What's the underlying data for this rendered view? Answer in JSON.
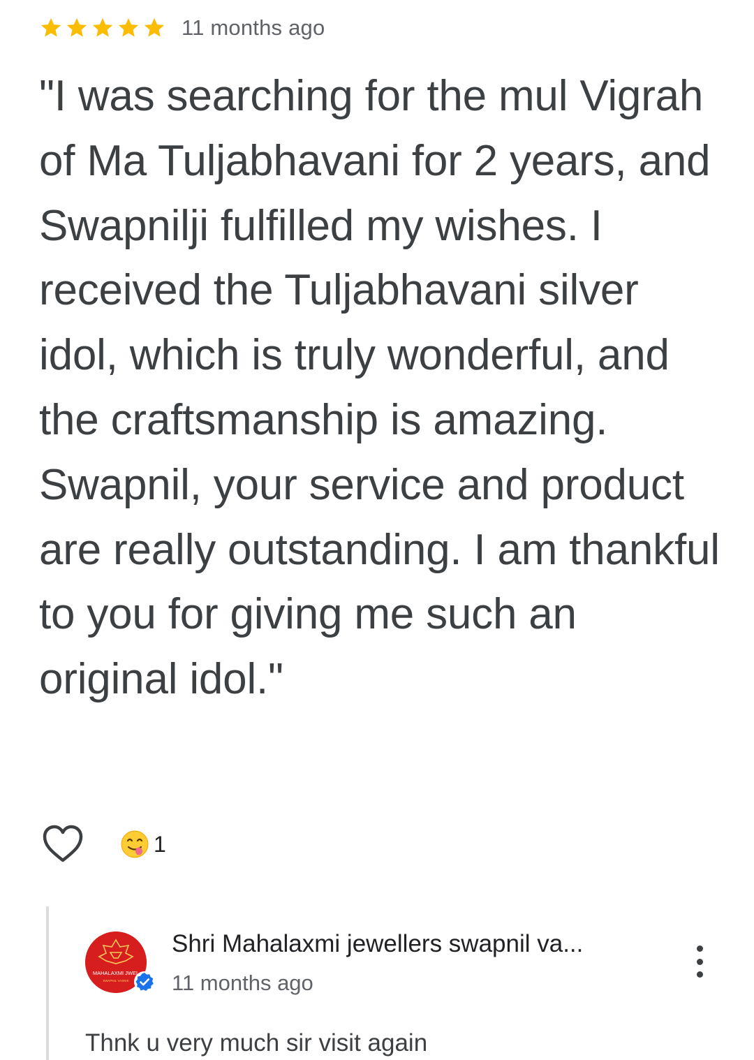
{
  "review": {
    "rating": 5,
    "max_rating": 5,
    "time": "11 months ago",
    "text": "\"I was searching for the mul Vigrah of Ma Tuljabhavani for 2 years, and Swapnilji fulfilled my wishes. I received the Tuljabhavani silver idol, which is truly wonderful, and the craftsmanship is amazing. Swapnil, your service and product are really outstanding. I am thankful to you for giving me such an original idol.\""
  },
  "reactions": {
    "like_icon": "heart-outline-icon",
    "emoji_icon": "savoring-food-emoji-icon",
    "emoji_count": "1"
  },
  "owner_reply": {
    "name": "Shri Mahalaxmi jewellers swapnil va...",
    "time": "11 months ago",
    "text": "Thnk u very much sir visit again",
    "avatar_label": "MAHALAXMI JWEL",
    "avatar_sublabel": "SWAPNIL VASNIK",
    "avatar_color": "#d71e1e",
    "verified_color": "#1a73e8",
    "more_icon": "more-vert-icon"
  },
  "colors": {
    "star": "#fbbc04",
    "text": "#3c4043",
    "secondary_text": "#5f6368",
    "reply_border": "#dadce0"
  }
}
